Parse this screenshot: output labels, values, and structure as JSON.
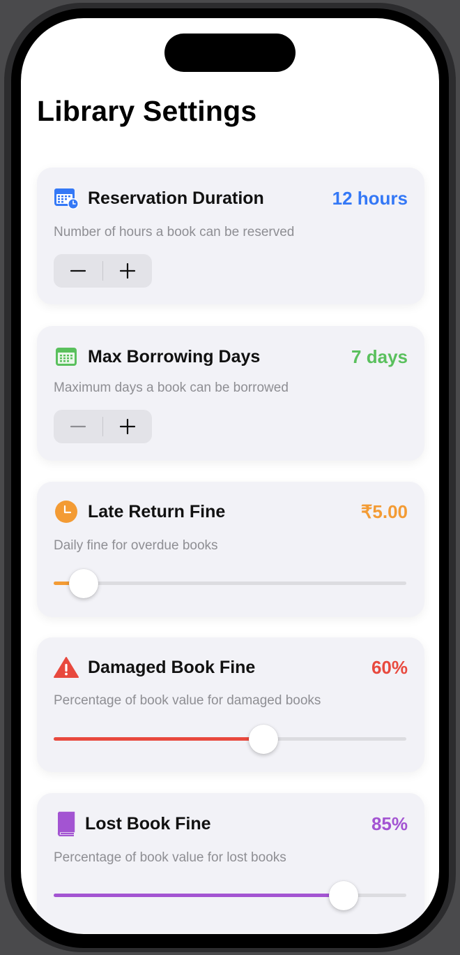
{
  "page": {
    "title": "Library Settings"
  },
  "colors": {
    "blue": "#3478f6",
    "green": "#5ac05d",
    "orange": "#f39b34",
    "red": "#e8493e",
    "purple": "#a354d2"
  },
  "reservation": {
    "title": "Reservation Duration",
    "value": "12 hours",
    "description": "Number of hours a book can be reserved",
    "icon": "calendar-clock-icon",
    "minus": "−",
    "plus": "+"
  },
  "borrowing": {
    "title": "Max Borrowing Days",
    "value": "7 days",
    "description": "Maximum days a book can be borrowed",
    "icon": "calendar-icon",
    "minus": "−",
    "plus": "+"
  },
  "late_fine": {
    "title": "Late Return Fine",
    "value": "₹5.00",
    "description": "Daily fine for overdue books",
    "icon": "clock-icon",
    "slider_level": 0.085
  },
  "damaged_fine": {
    "title": "Damaged Book Fine",
    "value": "60%",
    "description": "Percentage of book value for damaged books",
    "icon": "warning-triangle-icon",
    "slider_level": 0.595
  },
  "lost_fine": {
    "title": "Lost Book Fine",
    "value": "85%",
    "description": "Percentage of book value for lost books",
    "icon": "book-icon",
    "slider_level": 0.823
  }
}
